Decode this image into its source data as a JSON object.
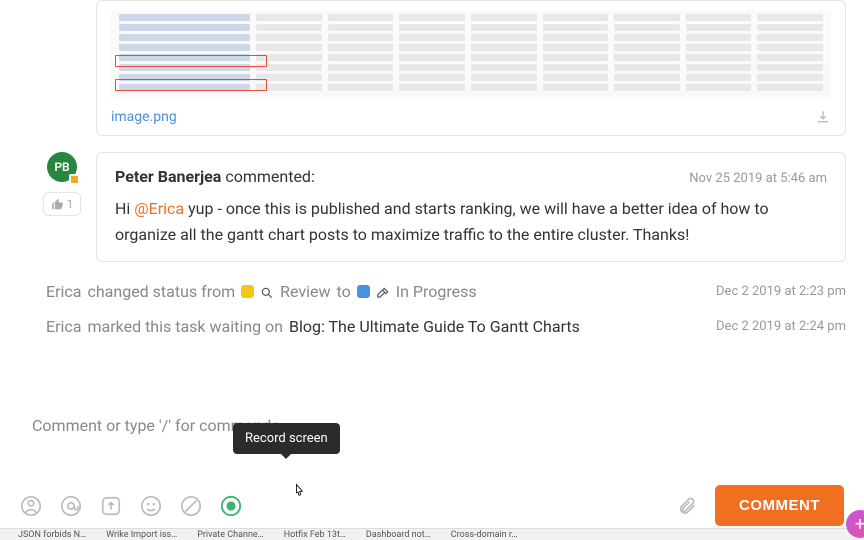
{
  "attachment": {
    "filename": "image.png"
  },
  "comment": {
    "avatar_initials": "PB",
    "author": "Peter Banerjea",
    "action": "commented:",
    "timestamp": "Nov 25 2019 at 5:46 am",
    "like_count": "1",
    "body_pre": "Hi ",
    "mention": "@Erica",
    "body_post": " yup - once this is published and starts ranking, we will have a better idea of how to organize all the gantt chart posts to maximize traffic to the entire cluster. Thanks!"
  },
  "activity": {
    "status_change": {
      "actor": "Erica",
      "verb": "changed status from",
      "from_label": "Review",
      "to_word": "to",
      "to_label": "In Progress",
      "timestamp": "Dec 2 2019 at 2:23 pm"
    },
    "waiting_on": {
      "actor": "Erica",
      "verb": "marked this task waiting on",
      "task": "Blog: The Ultimate Guide To Gantt Charts",
      "timestamp": "Dec 2 2019 at 2:24 pm"
    }
  },
  "input": {
    "placeholder": "Comment or type '/' for commands"
  },
  "tooltip": {
    "record_screen": "Record screen"
  },
  "buttons": {
    "comment": "COMMENT"
  },
  "bottom_tabs": [
    "JSON forbids N…",
    "Wrike Import iss…",
    "Private Channe…",
    "Hotfix Feb 13t…",
    "Dashboard not…",
    "Cross-domain r…"
  ]
}
